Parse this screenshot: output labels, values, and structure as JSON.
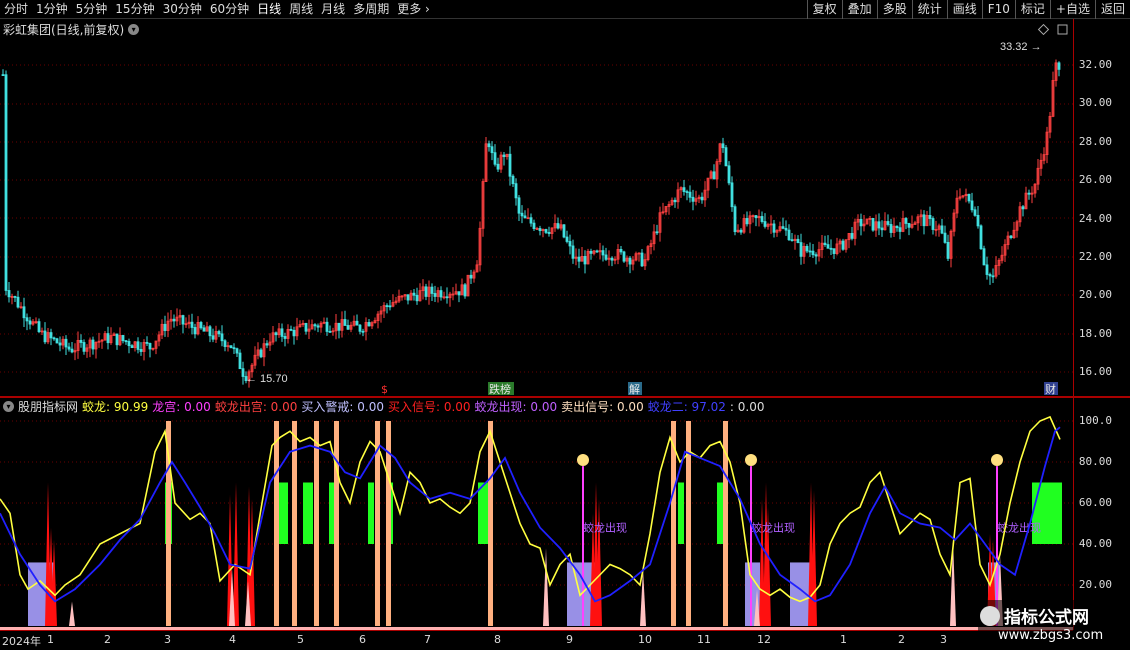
{
  "toolbar": {
    "periods": [
      "分时",
      "1分钟",
      "5分钟",
      "15分钟",
      "30分钟",
      "60分钟",
      "日线",
      "周线",
      "月线",
      "多周期",
      "更多"
    ],
    "active_period": "日线",
    "right_buttons": [
      "复权",
      "叠加",
      "多股",
      "统计",
      "画线",
      "F10",
      "标记",
      "+自选",
      "返回"
    ]
  },
  "stock_title": "彩虹集团(日线,前复权)",
  "price_axis": [
    "32.00",
    "30.00",
    "28.00",
    "26.00",
    "24.00",
    "22.00",
    "20.00",
    "18.00",
    "16.00"
  ],
  "price_annotations": {
    "high": "33.32",
    "low": "15.70"
  },
  "event_markers": [
    {
      "label": "$",
      "color": "#ff3030"
    },
    {
      "label": "跌榜",
      "color": "#e8e8e8",
      "bg": "#2a7a2a"
    },
    {
      "label": "解",
      "color": "#e8e8e8",
      "bg": "#2a6a8a"
    },
    {
      "label": "财",
      "color": "#e8e8e8",
      "bg": "#304090"
    }
  ],
  "indicator": {
    "name": "股朋指标网",
    "items": [
      {
        "label": "蛟龙:",
        "value": "90.99",
        "color": "#ffff40"
      },
      {
        "label": "龙宫:",
        "value": "0.00",
        "color": "#ff40ff"
      },
      {
        "label": "蛟龙出宫:",
        "value": "0.00",
        "color": "#ff4040"
      },
      {
        "label": "买入警戒:",
        "value": "0.00",
        "color": "#c0c0ff"
      },
      {
        "label": "买入信号:",
        "value": "0.00",
        "color": "#ff2020"
      },
      {
        "label": "蛟龙出现:",
        "value": "0.00",
        "color": "#c060ff"
      },
      {
        "label": "卖出信号:",
        "value": "0.00",
        "color": "#ffe0c0"
      },
      {
        "label": "蛟龙二:",
        "value": "97.02",
        "color": "#4040ff"
      },
      {
        "label": ":",
        "value": "0.00",
        "color": "#ddd"
      }
    ]
  },
  "indicator_axis": [
    "100.0",
    "80.00",
    "60.00",
    "40.00",
    "20.00"
  ],
  "signal_text": "蛟龙出现",
  "date_axis": [
    "2024年",
    "1",
    "2",
    "3",
    "4",
    "5",
    "6",
    "7",
    "8",
    "9",
    "10",
    "11",
    "12",
    "1",
    "2",
    "3"
  ],
  "watermark": {
    "title": "指标公式网",
    "url": "www.zbgs3.com"
  },
  "colors": {
    "up": "#ff4040",
    "down": "#40e0e0",
    "yellow": "#ffff40",
    "blue": "#2020ff",
    "green": "#20ff20",
    "orange": "#ffb080",
    "lavender": "#a8a0ff",
    "magenta": "#ff40ff"
  }
}
